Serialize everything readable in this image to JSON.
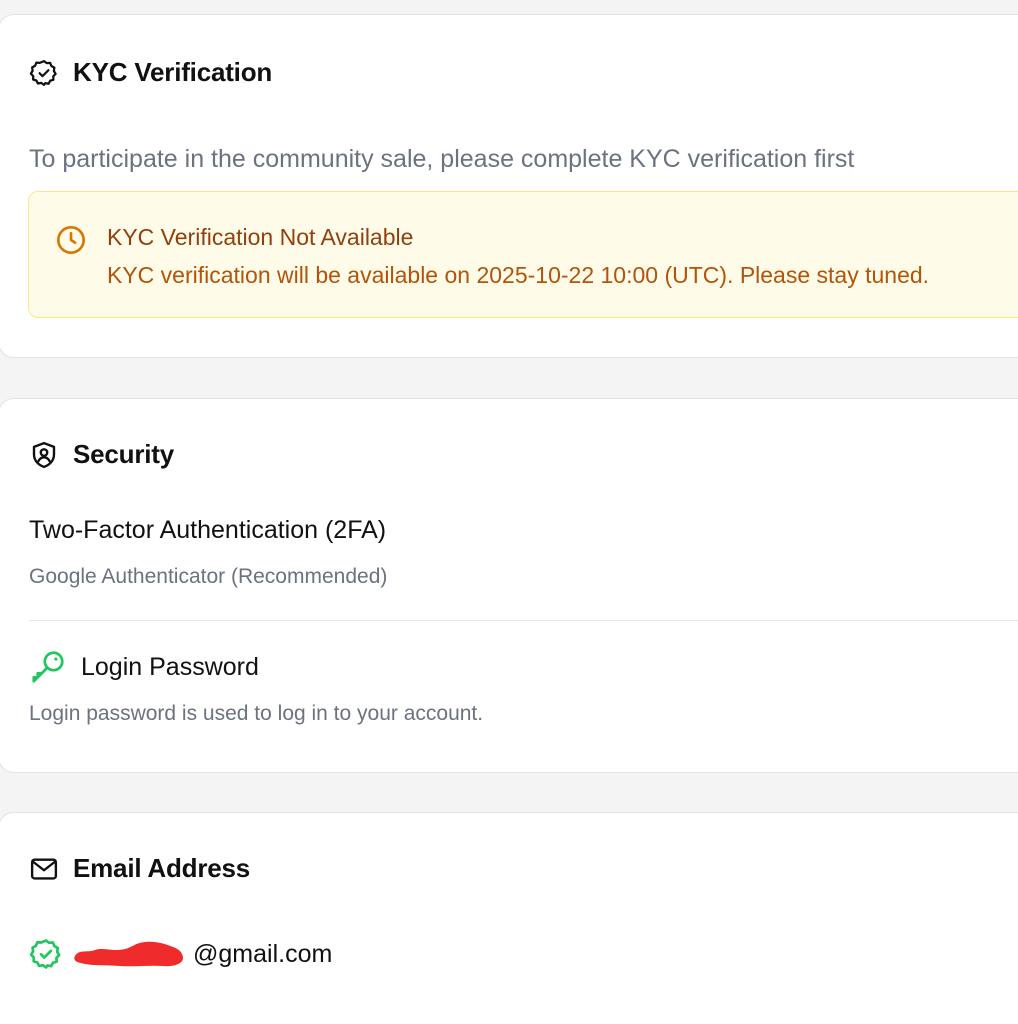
{
  "kyc": {
    "title": "KYC Verification",
    "description": "To participate in the community sale, please complete KYC verification first",
    "notice": {
      "title": "KYC Verification Not Available",
      "message": "KYC verification will be available on 2025-10-22 10:00 (UTC). Please stay tuned."
    },
    "icon": "check-badge-icon"
  },
  "security": {
    "title": "Security",
    "icon": "shield-user-icon",
    "two_factor": {
      "title": "Two-Factor Authentication (2FA)",
      "subtitle": "Google Authenticator (Recommended)"
    },
    "login_password": {
      "title": "Login Password",
      "subtitle": "Login password is used to log in to your account.",
      "icon": "key-icon"
    }
  },
  "email": {
    "title": "Email Address",
    "icon": "mail-icon",
    "address_domain": "@gmail.com",
    "verified_icon": "verified-check-icon"
  },
  "colors": {
    "notice_bg": "#fefce8",
    "notice_border": "#fde68a",
    "notice_title": "#92400e",
    "notice_text": "#b45309",
    "success": "#22c55e",
    "redaction": "#ef2b2b"
  }
}
